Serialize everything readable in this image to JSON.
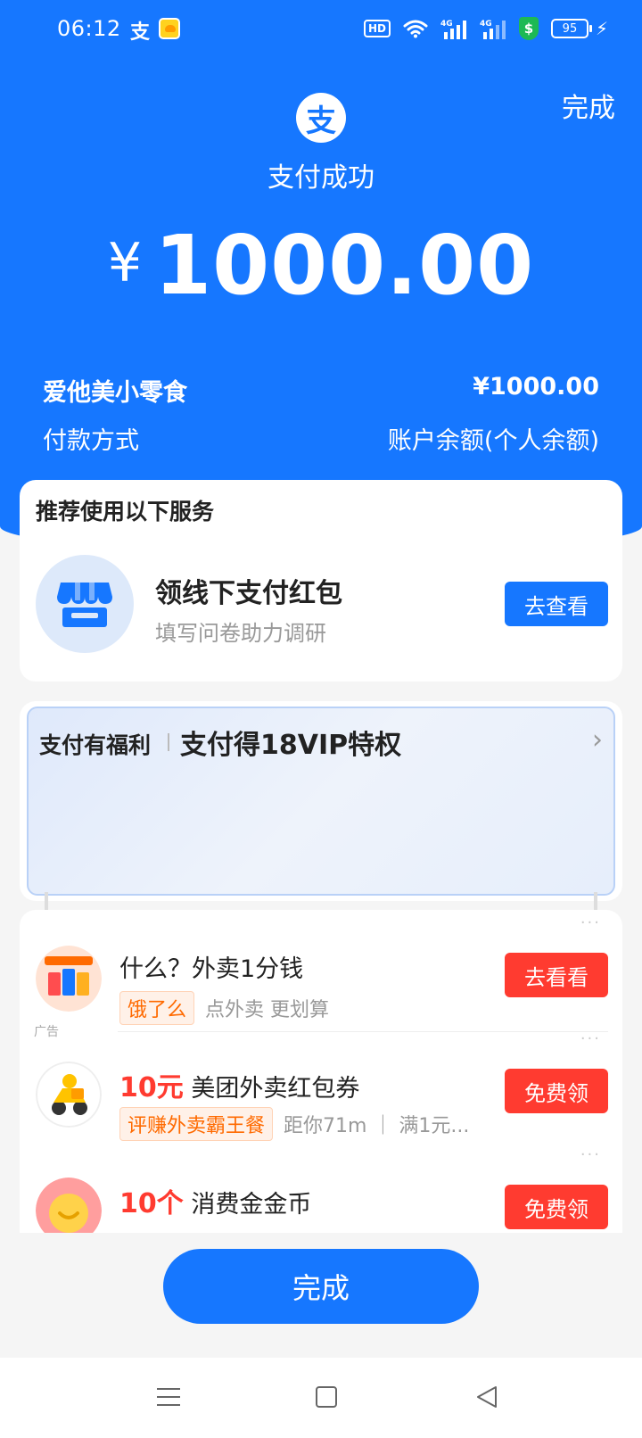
{
  "status_bar": {
    "time": "06:12",
    "alipay_glyph": "支",
    "hd_label": "HD",
    "signal_label": "4G",
    "shield_glyph": "$",
    "battery": "95",
    "icons": [
      "alipay-icon",
      "duck-app-icon",
      "hd-icon",
      "wifi-icon",
      "signal-icon",
      "shield-icon",
      "battery-icon",
      "charging-icon"
    ]
  },
  "header": {
    "done_label": "完成",
    "logo_glyph": "支",
    "success_text": "支付成功",
    "currency": "¥",
    "amount": "1000.00"
  },
  "payment_info": {
    "merchant": "爱他美小零食",
    "merchant_amount": "¥1000.00",
    "method_label": "付款方式",
    "method_value": "账户余额(个人余额)"
  },
  "recommend": {
    "title": "推荐使用以下服务",
    "main": "领线下支付红包",
    "sub": "填写问卷助力调研",
    "button": "去查看"
  },
  "benefit": {
    "label": "支付有福利",
    "title": "支付得18VIP特权",
    "arrow": "›"
  },
  "ads": {
    "dots": "···",
    "ad_label": "广告",
    "items": [
      {
        "highlight": "",
        "title": "什么？外卖1分钱",
        "tag": "饿了么",
        "desc": "点外卖 更划算",
        "button": "去看看"
      },
      {
        "highlight": "10元",
        "title": "美团外卖红包券",
        "tag": "评赚外卖霸王餐",
        "desc": "距你71m ｜ 满1元...",
        "button": "免费领"
      },
      {
        "highlight": "10个",
        "title": "消费金金币",
        "tag": "",
        "desc": "",
        "button": "免费领"
      }
    ]
  },
  "footer": {
    "done_button": "完成"
  },
  "colors": {
    "primary": "#1677ff",
    "danger": "#ff3b30",
    "tag_orange": "#ff6a00"
  }
}
